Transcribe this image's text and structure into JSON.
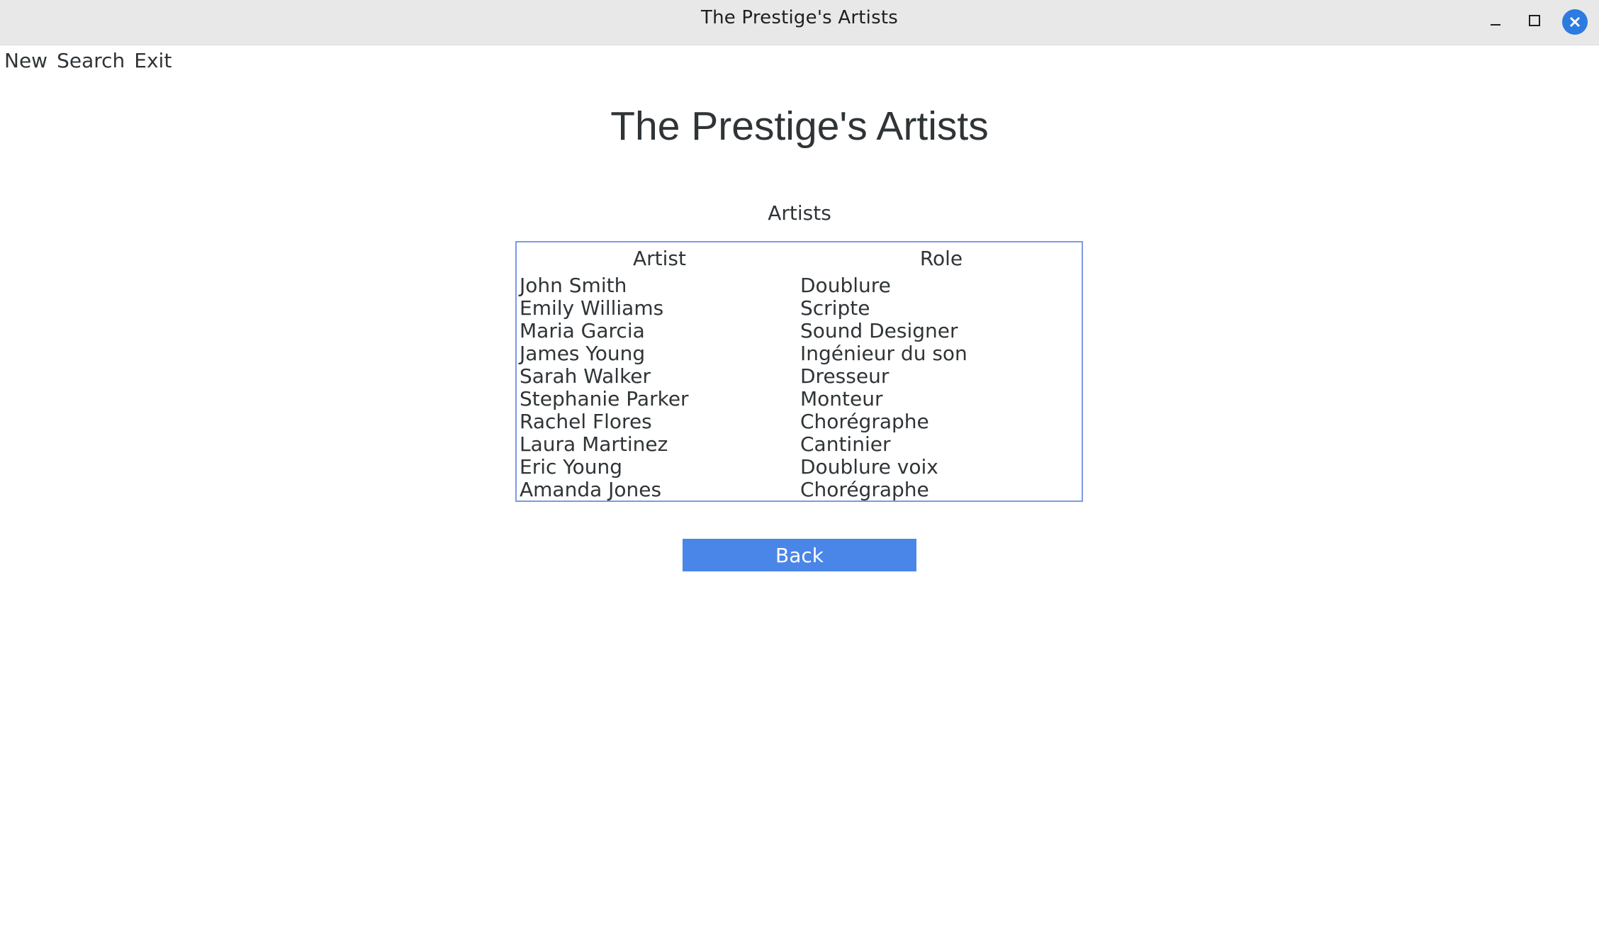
{
  "window": {
    "title": "The Prestige's Artists"
  },
  "menu": {
    "items": [
      {
        "label": "New"
      },
      {
        "label": "Search"
      },
      {
        "label": "Exit"
      }
    ]
  },
  "page": {
    "title": "The Prestige's Artists",
    "section_label": "Artists"
  },
  "table": {
    "columns": [
      "Artist",
      "Role"
    ],
    "rows": [
      {
        "artist": "John Smith",
        "role": "Doublure"
      },
      {
        "artist": "Emily Williams",
        "role": "Scripte"
      },
      {
        "artist": "Maria Garcia",
        "role": "Sound Designer"
      },
      {
        "artist": "James Young",
        "role": "Ingénieur du son"
      },
      {
        "artist": "Sarah Walker",
        "role": "Dresseur"
      },
      {
        "artist": "Stephanie Parker",
        "role": "Monteur"
      },
      {
        "artist": "Rachel Flores",
        "role": "Chorégraphe"
      },
      {
        "artist": "Laura Martinez",
        "role": "Cantinier"
      },
      {
        "artist": "Eric Young",
        "role": "Doublure voix"
      },
      {
        "artist": "Amanda Jones",
        "role": "Chorégraphe"
      }
    ]
  },
  "actions": {
    "back_label": "Back"
  },
  "icons": {
    "minimize": "minimize-icon",
    "maximize": "maximize-icon",
    "close": "close-icon"
  },
  "colors": {
    "accent": "#4a86e8",
    "close_button": "#2d7ae0",
    "table_border": "#7b9ae6",
    "titlebar_bg": "#e8e8e8"
  }
}
